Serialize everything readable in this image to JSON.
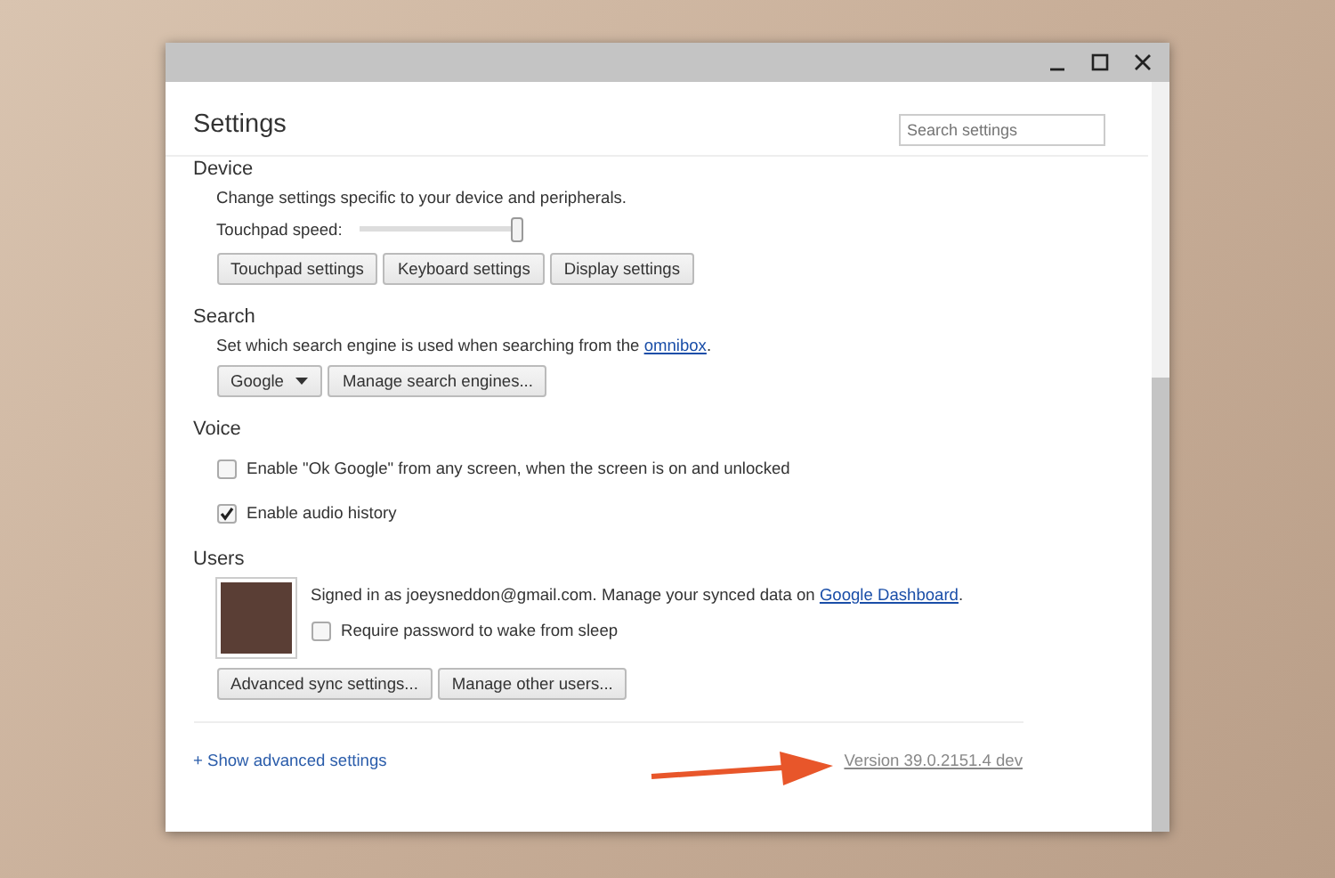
{
  "window": {
    "title": "Settings"
  },
  "search": {
    "placeholder": "Search settings"
  },
  "device": {
    "heading": "Device",
    "description": "Change settings specific to your device and peripherals.",
    "slider_label": "Touchpad speed:",
    "level": 1.0,
    "buttons": [
      "Touchpad settings",
      "Keyboard settings",
      "Display settings"
    ]
  },
  "search_section": {
    "heading": "Search",
    "description": "Set which search engine is used when searching from the ",
    "link": "omnibox",
    "after_link": ".",
    "engine": "Google",
    "manage_button": "Manage search engines..."
  },
  "voice": {
    "heading": "Voice",
    "options": [
      {
        "label": "Enable \"Ok Google\" from any screen, when the screen is on and unlocked",
        "checked": false
      },
      {
        "label": "Enable audio history",
        "checked": true
      }
    ]
  },
  "users": {
    "heading": "Users",
    "signed_in": "Signed in as joeysneddon@gmail.com. Manage your synced data on ",
    "link": "Google Dashboard",
    "after_link": ".",
    "options": [
      {
        "label": "Require password to wake from sleep",
        "checked": false
      }
    ],
    "buttons": [
      "Advanced sync settings...",
      "Manage other users..."
    ]
  },
  "footer": {
    "advanced_link": "+ Show advanced settings",
    "version": "Version 39.0.2151.4 dev"
  }
}
